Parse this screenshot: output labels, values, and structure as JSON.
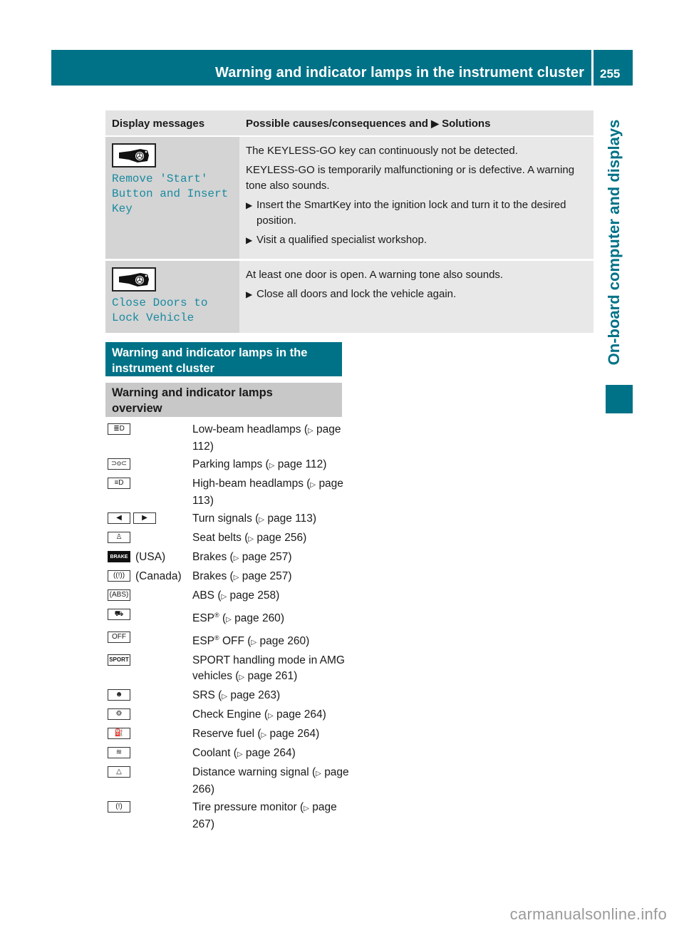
{
  "header": {
    "title": "Warning and indicator lamps in the instrument cluster",
    "page_number": "255",
    "side_tab": "On-board computer and displays",
    "accent_color": "#007287"
  },
  "table": {
    "columns": [
      "Display messages",
      "Possible causes/consequences and",
      "Solutions"
    ],
    "rows": [
      {
        "icon": "keyless-go-key-icon",
        "message": "Remove 'Start'\nButton and Insert\nKey",
        "paragraphs": [
          "The KEYLESS-GO key can continuously not be detected.",
          "KEYLESS-GO is temporarily malfunctioning or is defective. A warning tone also sounds."
        ],
        "steps": [
          "Insert the SmartKey into the ignition lock and turn it to the desired position.",
          "Visit a qualified specialist workshop."
        ]
      },
      {
        "icon": "keyless-go-key-icon",
        "message": "Close Doors to\nLock Vehicle",
        "paragraphs": [
          "At least one door is open. A warning tone also sounds."
        ],
        "steps": [
          "Close all doors and lock the vehicle again."
        ]
      }
    ]
  },
  "section": {
    "heading": "Warning and indicator lamps in the instrument cluster",
    "subheading": "Warning and indicator lamps overview"
  },
  "page_ref_symbol": "▷",
  "lamps": [
    {
      "icon": "low-beam-icon",
      "glyph": "≣D",
      "region": "",
      "label": "Low-beam headlamps",
      "ref": "page 112"
    },
    {
      "icon": "parking-lamps-icon",
      "glyph": "⊃o⊂",
      "region": "",
      "label": "Parking lamps",
      "ref": "page 112"
    },
    {
      "icon": "high-beam-icon",
      "glyph": "≡D",
      "region": "",
      "label": "High-beam headlamps",
      "ref": "page 113"
    },
    {
      "icon": "turn-signals-icon",
      "glyph": "⇦ ⇨",
      "region": "",
      "label": "Turn signals",
      "ref": "page 113"
    },
    {
      "icon": "seat-belt-icon",
      "glyph": "♙",
      "region": "",
      "label": "Seat belts",
      "ref": "page 256"
    },
    {
      "icon": "brake-usa-icon",
      "glyph": "BRAKE",
      "region": "(USA)",
      "label": "Brakes",
      "ref": "page 257"
    },
    {
      "icon": "brake-canada-icon",
      "glyph": "((!))",
      "region": "(Canada)",
      "label": "Brakes",
      "ref": "page 257"
    },
    {
      "icon": "abs-icon",
      "glyph": "(ABS)",
      "region": "",
      "label": "ABS",
      "ref": "page 258"
    },
    {
      "icon": "esp-icon",
      "glyph": "⛟",
      "region": "",
      "label": "ESP® ",
      "ref": "page 260"
    },
    {
      "icon": "esp-off-icon",
      "glyph": "OFF",
      "region": "",
      "label": "ESP® OFF",
      "ref": "page 260"
    },
    {
      "icon": "sport-icon",
      "glyph": "SPORT",
      "region": "",
      "label": "SPORT handling mode in AMG vehicles",
      "ref": "page 261"
    },
    {
      "icon": "srs-icon",
      "glyph": "☻",
      "region": "",
      "label": "SRS",
      "ref": "page 263"
    },
    {
      "icon": "check-engine-icon",
      "glyph": "⚙",
      "region": "",
      "label": "Check Engine",
      "ref": "page 264"
    },
    {
      "icon": "reserve-fuel-icon",
      "glyph": "⛽",
      "region": "",
      "label": "Reserve fuel",
      "ref": "page 264"
    },
    {
      "icon": "coolant-icon",
      "glyph": "≋",
      "region": "",
      "label": "Coolant",
      "ref": "page 264"
    },
    {
      "icon": "distance-warning-icon",
      "glyph": "△",
      "region": "",
      "label": "Distance warning signal",
      "ref": "page 266"
    },
    {
      "icon": "tire-pressure-icon",
      "glyph": "(!)",
      "region": "",
      "label": "Tire pressure monitor",
      "ref": "page 267"
    }
  ],
  "watermark": "carmanualsonline.info"
}
